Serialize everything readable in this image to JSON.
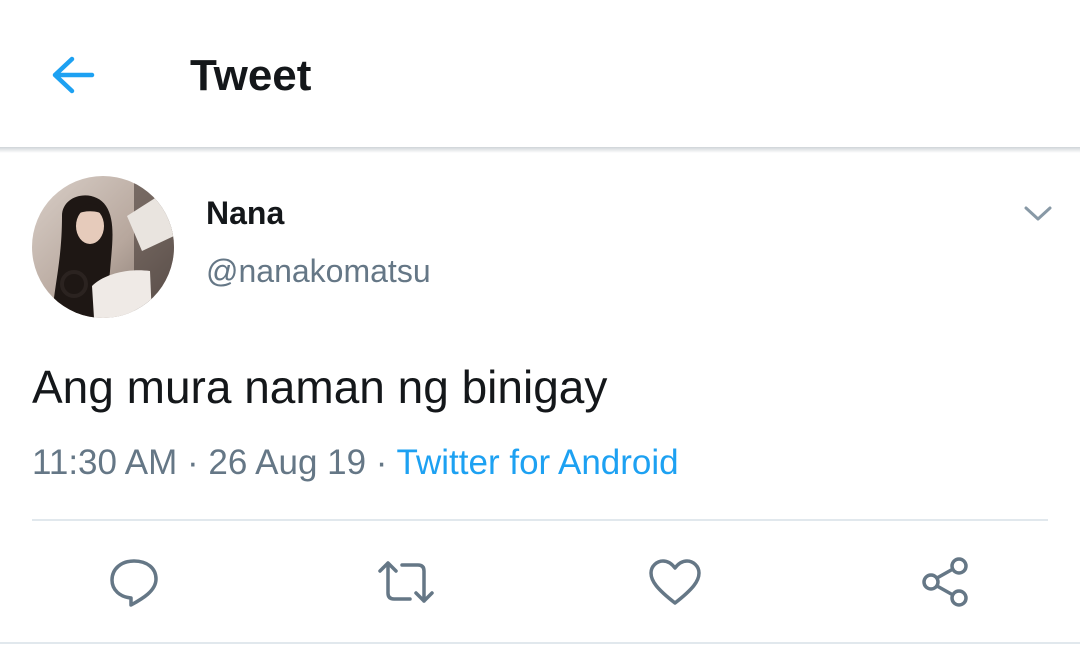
{
  "header": {
    "title": "Tweet",
    "back_icon": "arrow-left-icon"
  },
  "tweet": {
    "author": {
      "name": "Nana",
      "handle": "@nanakomatsu",
      "avatar_icon": "profile-photo"
    },
    "text": "Ang mura naman ng binigay",
    "time": "11:30 AM",
    "date": "26 Aug 19",
    "separator": "·",
    "source": "Twitter for Android",
    "menu_icon": "chevron-down-icon"
  },
  "actions": [
    {
      "name": "reply",
      "icon": "reply-icon"
    },
    {
      "name": "retweet",
      "icon": "retweet-icon"
    },
    {
      "name": "like",
      "icon": "heart-icon"
    },
    {
      "name": "share",
      "icon": "share-icon"
    }
  ],
  "colors": {
    "accent": "#1da1f2",
    "text_primary": "#14171a",
    "text_secondary": "#657786",
    "divider": "#e1e8ed"
  }
}
